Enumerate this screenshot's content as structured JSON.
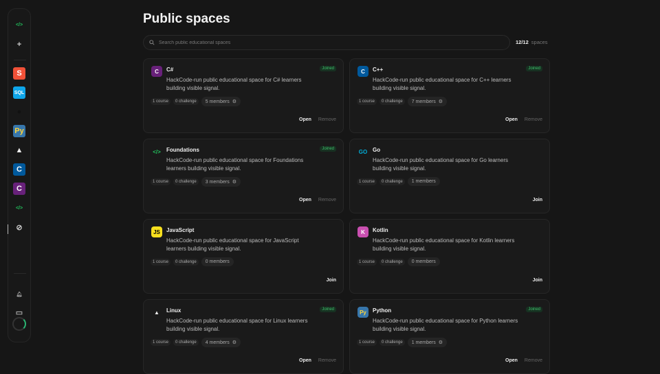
{
  "page": {
    "title": "Public spaces",
    "search_placeholder": "Search public educational spaces",
    "count": "12/12",
    "count_label": "spaces"
  },
  "sidebar": {
    "items": [
      {
        "name": "code",
        "glyph": "</>",
        "color": "#22c55e",
        "bg": "transparent"
      },
      {
        "name": "add",
        "glyph": "+",
        "color": "#ccc",
        "bg": "transparent"
      },
      {
        "name": "swift",
        "glyph": "S",
        "color": "#fff",
        "bg": "#f05138"
      },
      {
        "name": "sql",
        "glyph": "SQL",
        "color": "#fff",
        "bg": "#0ea5e9"
      },
      {
        "name": "github",
        "glyph": "●",
        "color": "#111",
        "bg": "transparent"
      },
      {
        "name": "python",
        "glyph": "Py",
        "color": "#ffd43b",
        "bg": "#3776ab"
      },
      {
        "name": "linux",
        "glyph": "▲",
        "color": "#eee",
        "bg": "transparent"
      },
      {
        "name": "cpp",
        "glyph": "C",
        "color": "#fff",
        "bg": "#00599c"
      },
      {
        "name": "csharp",
        "glyph": "C",
        "color": "#fff",
        "bg": "#68217a"
      },
      {
        "name": "foundations",
        "glyph": "</>",
        "color": "#22c55e",
        "bg": "transparent"
      },
      {
        "name": "explore",
        "glyph": "⊘",
        "color": "#ccc",
        "bg": "transparent"
      },
      {
        "name": "notifications",
        "glyph": "🔔︎",
        "color": "#aaa",
        "bg": "transparent"
      },
      {
        "name": "feedback",
        "glyph": "▭",
        "color": "#aaa",
        "bg": "transparent"
      }
    ]
  },
  "labels": {
    "open": "Open",
    "remove": "Remove",
    "join": "Join",
    "joined": "Joined"
  },
  "cards": [
    {
      "name": "C#",
      "icon": "C",
      "color": "#fff",
      "bg": "#68217a",
      "desc": "HackCode-run public educational space for C# learners building visible signal.",
      "course": "1 course",
      "challenge": "0 challenge",
      "members": "5 members",
      "joined": true
    },
    {
      "name": "C++",
      "icon": "C",
      "color": "#fff",
      "bg": "#00599c",
      "desc": "HackCode-run public educational space for C++ learners building visible signal.",
      "course": "1 course",
      "challenge": "0 challenge",
      "members": "7 members",
      "joined": true
    },
    {
      "name": "Foundations",
      "icon": "</>",
      "color": "#22c55e",
      "bg": "transparent",
      "desc": "HackCode-run public educational space for Foundations learners building visible signal.",
      "course": "1 course",
      "challenge": "0 challenge",
      "members": "3 members",
      "joined": true
    },
    {
      "name": "Go",
      "icon": "GO",
      "color": "#00add8",
      "bg": "transparent",
      "desc": "HackCode-run public educational space for Go learners building visible signal.",
      "course": "1 course",
      "challenge": "0 challenge",
      "members": "1 members",
      "joined": false
    },
    {
      "name": "JavaScript",
      "icon": "JS",
      "color": "#000",
      "bg": "#f7df1e",
      "desc": "HackCode-run public educational space for JavaScript learners building visible signal.",
      "course": "1 course",
      "challenge": "0 challenge",
      "members": "0 members",
      "joined": false
    },
    {
      "name": "Kotlin",
      "icon": "K",
      "color": "#fff",
      "bg": "#c94fb0",
      "desc": "HackCode-run public educational space for Kotlin learners building visible signal.",
      "course": "1 course",
      "challenge": "0 challenge",
      "members": "0 members",
      "joined": false
    },
    {
      "name": "Linux",
      "icon": "▲",
      "color": "#eee",
      "bg": "transparent",
      "desc": "HackCode-run public educational space for Linux learners building visible signal.",
      "course": "1 course",
      "challenge": "0 challenge",
      "members": "4 members",
      "joined": true
    },
    {
      "name": "Python",
      "icon": "Py",
      "color": "#ffd43b",
      "bg": "#3776ab",
      "desc": "HackCode-run public educational space for Python learners building visible signal.",
      "course": "1 course",
      "challenge": "0 challenge",
      "members": "1 members",
      "joined": true
    }
  ]
}
